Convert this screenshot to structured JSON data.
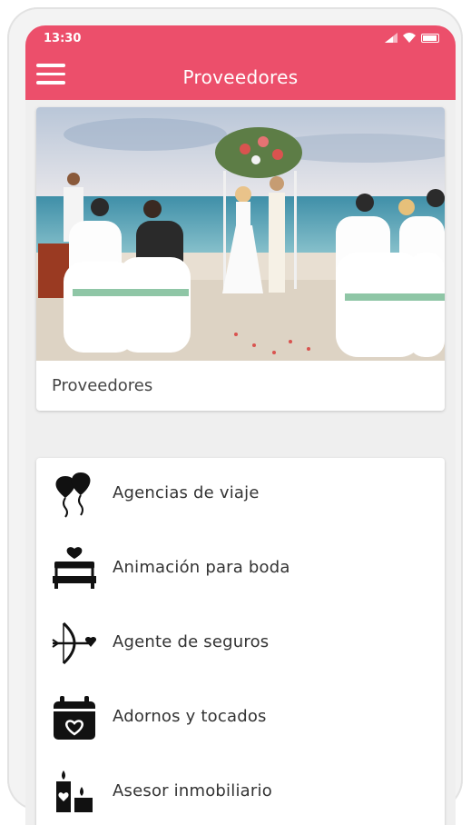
{
  "status": {
    "time": "13:30"
  },
  "header": {
    "title": "Proveedores"
  },
  "hero": {
    "caption": "Proveedores",
    "image_alt": "Beach wedding ceremony"
  },
  "categories": [
    {
      "label": "Agencias de viaje",
      "icon": "heart-balloons-icon"
    },
    {
      "label": "Animación para boda",
      "icon": "heart-bed-icon"
    },
    {
      "label": "Agente de seguros",
      "icon": "cupid-bow-icon"
    },
    {
      "label": "Adornos y tocados",
      "icon": "heart-calendar-icon"
    },
    {
      "label": "Asesor inmobiliario",
      "icon": "heart-candles-icon"
    }
  ],
  "colors": {
    "accent": "#ec4f6b"
  }
}
